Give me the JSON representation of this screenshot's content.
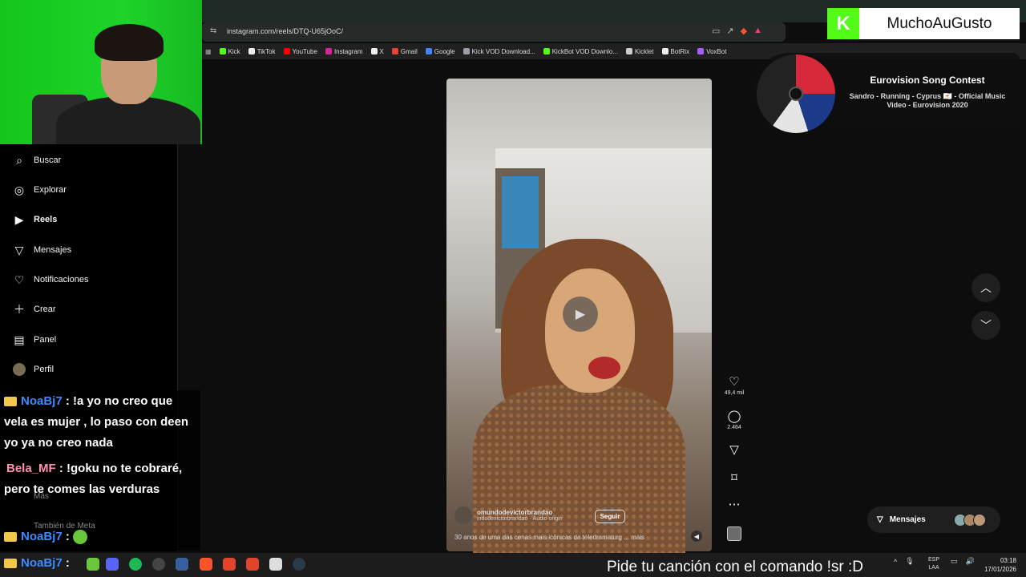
{
  "browser": {
    "url": "instagram.com/reels/DTQ-U65jOoC/",
    "bookmarks": [
      {
        "label": "Kick",
        "color": "#53fc18"
      },
      {
        "label": "TikTok",
        "color": "#ffffff"
      },
      {
        "label": "YouTube",
        "color": "#ff0000"
      },
      {
        "label": "Instagram",
        "color": "#d6249f"
      },
      {
        "label": "X",
        "color": "#ffffff"
      },
      {
        "label": "Gmail",
        "color": "#ea4335"
      },
      {
        "label": "Google",
        "color": "#4285f4"
      },
      {
        "label": "Kick VOD Download...",
        "color": "#9aa0a6"
      },
      {
        "label": "KickBot VOD Downlo...",
        "color": "#53fc18"
      },
      {
        "label": "Kicklet",
        "color": "#cccccc"
      },
      {
        "label": "BotRix",
        "color": "#ffffff"
      },
      {
        "label": "VoxBot",
        "color": "#a45cff"
      }
    ]
  },
  "sidebar": {
    "items": [
      {
        "label": "Buscar",
        "icon": "search-icon"
      },
      {
        "label": "Explorar",
        "icon": "compass-icon"
      },
      {
        "label": "Reels",
        "icon": "reels-icon"
      },
      {
        "label": "Mensajes",
        "icon": "send-icon"
      },
      {
        "label": "Notificaciones",
        "icon": "heart-icon"
      },
      {
        "label": "Crear",
        "icon": "plus-icon"
      },
      {
        "label": "Panel",
        "icon": "panel-icon"
      },
      {
        "label": "Perfil",
        "icon": "avatar"
      }
    ],
    "faded_more": "Más",
    "faded_meta": "También de Meta"
  },
  "chat": {
    "messages": [
      {
        "user": "NoaBj7",
        "text": ": !a yo no creo que vela es mujer , lo paso con deen yo ya no creo nada"
      },
      {
        "user": "Bela_MF",
        "text": ": !goku no te cobraré, pero te comes las verduras"
      },
      {
        "user": "NoaBj7",
        "text": ":"
      },
      {
        "user": "NoaBj7",
        "text": ":"
      }
    ]
  },
  "reel": {
    "username": "omundodevictorbrandao",
    "audio": "indodevictorbrandao · Áudio origin",
    "follow_label": "Seguir",
    "caption": "30 anos de uma das cenas mais icônicas da teledramaturg ... mais",
    "likes": "49,4 mil",
    "comments": "2.464"
  },
  "messages_pill": {
    "label": "Mensajes"
  },
  "overlay": {
    "brand": "MuchoAuGusto",
    "now_playing_title": "Eurovision Song Contest",
    "now_playing_subtitle": "Sandro - Running - Cyprus 🇨🇾 - Official Music Video - Eurovision 2020",
    "song_request": "Pide tu canción con el comando !sr :D"
  },
  "taskbar": {
    "lang": "ESP",
    "lang2": "LAA",
    "time": "03:18",
    "date": "17/01/2026"
  },
  "colors": {
    "kick_green": "#53fc18",
    "chat_user_blue": "#3d8bff",
    "chat_user_pink": "#ff8fb4"
  }
}
